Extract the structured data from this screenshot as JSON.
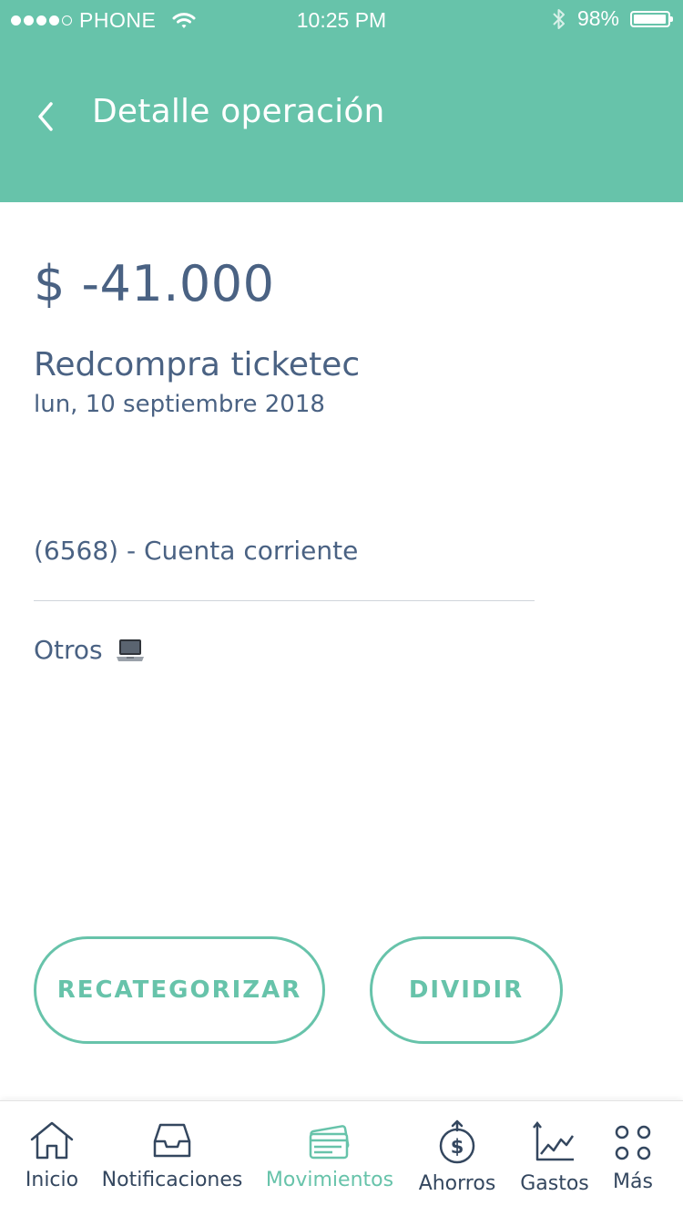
{
  "status_bar": {
    "carrier": "PHONE",
    "time": "10:25 PM",
    "battery": "98%",
    "signal_dots_filled": 4,
    "signal_dots_total": 5
  },
  "header": {
    "title": "Detalle operación",
    "back_icon": "chevron-left-icon"
  },
  "transaction": {
    "amount": "$ -41.000",
    "merchant": "Redcompra ticketec",
    "date": "lun, 10 septiembre 2018",
    "account": "(6568) - Cuenta corriente",
    "category": "Otros",
    "category_icon": "laptop-icon"
  },
  "actions": {
    "recategorize_label": "RECATEGORIZAR",
    "split_label": "DIVIDIR"
  },
  "tabbar": {
    "active": "Movimientos",
    "items": [
      {
        "label": "Inicio",
        "icon": "home-icon"
      },
      {
        "label": "Notificaciones",
        "icon": "inbox-icon"
      },
      {
        "label": "Movimientos",
        "icon": "cards-icon"
      },
      {
        "label": "Ahorros",
        "icon": "savings-icon"
      },
      {
        "label": "Gastos",
        "icon": "chart-icon"
      },
      {
        "label": "Más",
        "icon": "more-icon"
      }
    ]
  },
  "colors": {
    "brand": "#67c3aa",
    "text": "#4a6283",
    "tab_text": "#34475f"
  }
}
